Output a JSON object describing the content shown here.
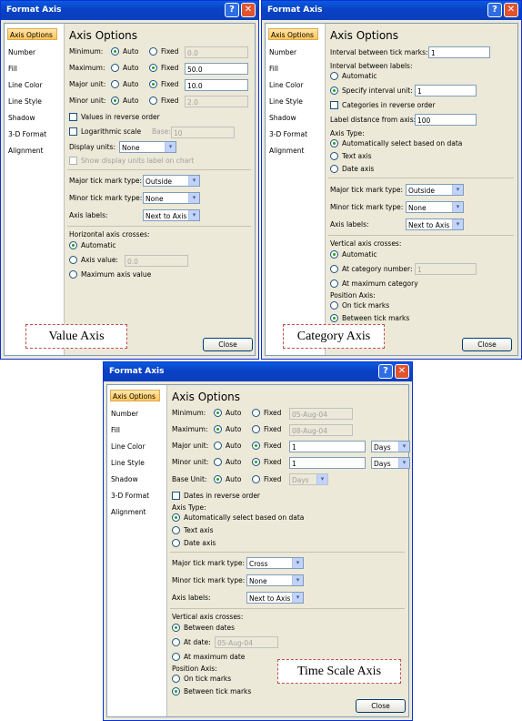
{
  "common": {
    "help_symbol": "?",
    "close_symbol": "✕",
    "dropdown_symbol": "▾",
    "sidebar": [
      "Axis Options",
      "Number",
      "Fill",
      "Line Color",
      "Line Style",
      "Shadow",
      "3-D Format",
      "Alignment"
    ],
    "heading": "Axis Options",
    "close_button": "Close"
  },
  "value_dialog": {
    "title": "Format Axis",
    "caption": "Value Axis",
    "minimum": {
      "label": "Minimum:",
      "auto": "Auto",
      "fixed": "Fixed",
      "value": "0.0",
      "selected": "auto"
    },
    "maximum": {
      "label": "Maximum:",
      "auto": "Auto",
      "fixed": "Fixed",
      "value": "50.0",
      "selected": "fixed"
    },
    "major_unit": {
      "label": "Major unit:",
      "auto": "Auto",
      "fixed": "Fixed",
      "value": "10.0",
      "selected": "fixed"
    },
    "minor_unit": {
      "label": "Minor unit:",
      "auto": "Auto",
      "fixed": "Fixed",
      "value": "2.0",
      "selected": "auto"
    },
    "reverse": "Values in reverse order",
    "log_scale": "Logarithmic scale",
    "base_label": "Base:",
    "base_value": "10",
    "display_units_label": "Display units:",
    "display_units_value": "None",
    "show_units": "Show display units label on chart",
    "major_tick_label": "Major tick mark type:",
    "major_tick_value": "Outside",
    "minor_tick_label": "Minor tick mark type:",
    "minor_tick_value": "None",
    "axis_labels_label": "Axis labels:",
    "axis_labels_value": "Next to Axis",
    "crosses_label": "Horizontal axis crosses:",
    "cross_auto": "Automatic",
    "cross_value_label": "Axis value:",
    "cross_value": "0.0",
    "cross_max": "Maximum axis value"
  },
  "category_dialog": {
    "title": "Format Axis",
    "caption": "Category Axis",
    "interval_ticks_label": "Interval between tick marks:",
    "interval_ticks_value": "1",
    "interval_labels_label": "Interval between labels:",
    "automatic": "Automatic",
    "specify": "Specify interval unit:",
    "specify_value": "1",
    "reverse": "Categories in reverse order",
    "label_distance_label": "Label distance from axis:",
    "label_distance_value": "100",
    "axis_type_label": "Axis Type:",
    "type_auto": "Automatically select based on data",
    "type_text": "Text axis",
    "type_date": "Date axis",
    "major_tick_label": "Major tick mark type:",
    "major_tick_value": "Outside",
    "minor_tick_label": "Minor tick mark type:",
    "minor_tick_value": "None",
    "axis_labels_label": "Axis labels:",
    "axis_labels_value": "Next to Axis",
    "crosses_label": "Vertical axis crosses:",
    "cross_auto": "Automatic",
    "cross_cat_label": "At category number:",
    "cross_cat_value": "1",
    "cross_max": "At maximum category",
    "position_label": "Position Axis:",
    "pos_on": "On tick marks",
    "pos_between": "Between tick marks"
  },
  "time_dialog": {
    "title": "Format Axis",
    "caption": "Time Scale Axis",
    "minimum": {
      "label": "Minimum:",
      "auto": "Auto",
      "fixed": "Fixed",
      "value": "05-Aug-04"
    },
    "maximum": {
      "label": "Maximum:",
      "auto": "Auto",
      "fixed": "Fixed",
      "value": "08-Aug-04"
    },
    "major_unit": {
      "label": "Major unit:",
      "auto": "Auto",
      "fixed": "Fixed",
      "value": "1",
      "unit": "Days"
    },
    "minor_unit": {
      "label": "Minor unit:",
      "auto": "Auto",
      "fixed": "Fixed",
      "value": "1",
      "unit": "Days"
    },
    "base_unit": {
      "label": "Base Unit:",
      "auto": "Auto",
      "fixed": "Fixed",
      "unit": "Days"
    },
    "reverse": "Dates in reverse order",
    "axis_type_label": "Axis Type:",
    "type_auto": "Automatically select based on data",
    "type_text": "Text axis",
    "type_date": "Date axis",
    "major_tick_label": "Major tick mark type:",
    "major_tick_value": "Cross",
    "minor_tick_label": "Minor tick mark type:",
    "minor_tick_value": "None",
    "axis_labels_label": "Axis labels:",
    "axis_labels_value": "Next to Axis",
    "crosses_label": "Vertical axis crosses:",
    "cross_between": "Between dates",
    "cross_date_label": "At date:",
    "cross_date_value": "05-Aug-04",
    "cross_max": "At maximum date",
    "position_label": "Position Axis:",
    "pos_on": "On tick marks",
    "pos_between": "Between tick marks"
  }
}
